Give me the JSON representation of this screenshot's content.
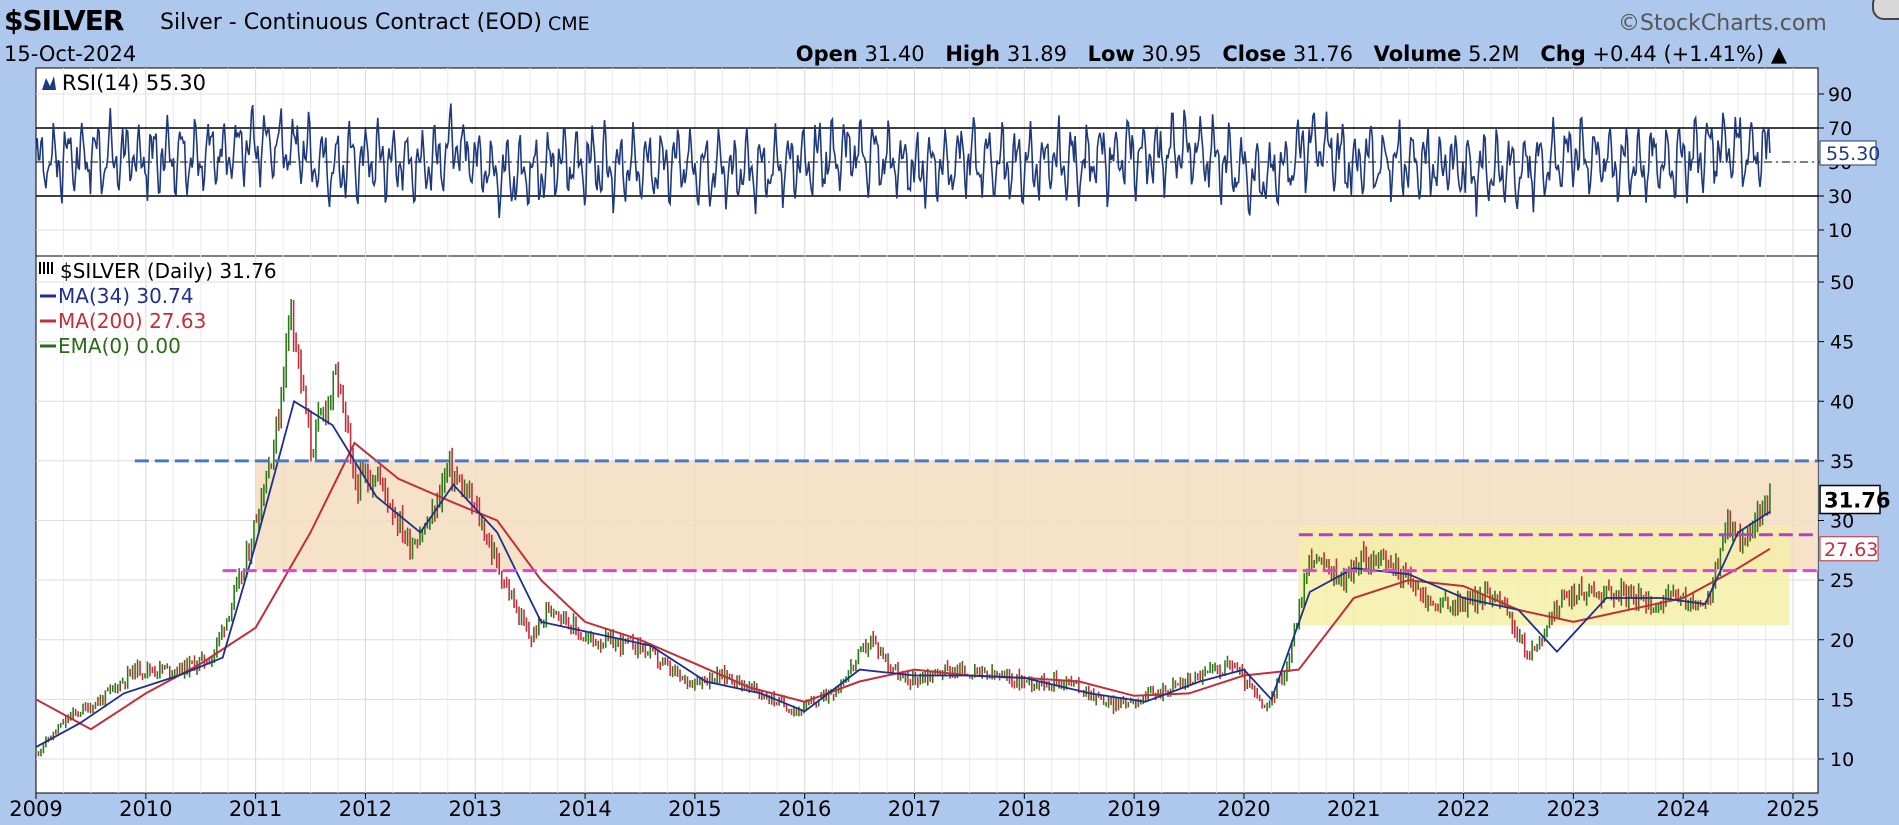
{
  "header": {
    "symbol": "$SILVER",
    "description": "Silver - Continuous Contract (EOD)",
    "exchange": "CME",
    "date": "15-Oct-2024",
    "brand": "©StockCharts.com",
    "open_label": "Open",
    "open": "31.40",
    "high_label": "High",
    "high": "31.89",
    "low_label": "Low",
    "low": "30.95",
    "close_label": "Close",
    "close": "31.76",
    "volume_label": "Volume",
    "volume": "5.2M",
    "chg_label": "Chg",
    "chg": "+0.44 (+1.41%)",
    "chg_arrow": "▲"
  },
  "rsi_panel": {
    "legend": "RSI(14) 55.30",
    "last_value_tag": "55.30",
    "ticks": [
      90,
      70,
      50,
      30,
      10
    ],
    "tick_labels": [
      "90",
      "70",
      "50",
      "30",
      "10"
    ]
  },
  "price_panel": {
    "legend": [
      {
        "text": "$SILVER (Daily) 31.76",
        "color": "#000000"
      },
      {
        "text": "MA(34) 30.74",
        "color": "#1f2f8a"
      },
      {
        "text": "MA(200) 27.63",
        "color": "#c0303a"
      },
      {
        "text": "EMA(0) 0.00",
        "color": "#2a6a1a"
      }
    ],
    "close_tag": "31.76",
    "ma200_tag": "27.63",
    "x_labels": [
      "2009",
      "2010",
      "2011",
      "2012",
      "2013",
      "2014",
      "2015",
      "2016",
      "2017",
      "2018",
      "2019",
      "2020",
      "2021",
      "2022",
      "2023",
      "2024",
      "2025"
    ],
    "y_labels": [
      "50",
      "45",
      "40",
      "35",
      "30",
      "25",
      "20",
      "15",
      "10"
    ]
  },
  "chart_data": [
    {
      "type": "line",
      "title": "RSI(14)",
      "ylim": [
        0,
        100
      ],
      "reference_lines": [
        70,
        50,
        30
      ],
      "last_value": 55.3,
      "series": [
        {
          "name": "RSI(14)",
          "color": "#1f3a7a",
          "x": [
            2009.0,
            2009.5,
            2010.0,
            2010.5,
            2011.0,
            2011.3,
            2011.7,
            2012.0,
            2012.5,
            2012.8,
            2013.3,
            2013.7,
            2014.0,
            2014.5,
            2015.0,
            2015.5,
            2016.0,
            2016.5,
            2017.0,
            2017.5,
            2018.0,
            2018.5,
            2019.0,
            2019.5,
            2020.0,
            2020.2,
            2020.6,
            2021.0,
            2021.5,
            2022.0,
            2022.5,
            2023.0,
            2023.5,
            2024.0,
            2024.4,
            2024.79
          ],
          "values": [
            50,
            62,
            55,
            65,
            72,
            80,
            42,
            55,
            45,
            78,
            25,
            45,
            50,
            40,
            48,
            30,
            55,
            65,
            40,
            55,
            45,
            50,
            60,
            70,
            40,
            15,
            82,
            45,
            55,
            40,
            35,
            65,
            45,
            55,
            80,
            55.3
          ]
        }
      ]
    },
    {
      "type": "line",
      "title": "$SILVER (Daily) 31.76",
      "ylim": [
        8,
        51
      ],
      "x_range": [
        2009.0,
        2025.0
      ],
      "series": [
        {
          "name": "$SILVER (Daily)",
          "color": "#2a6a1a",
          "x": [
            2009.0,
            2009.3,
            2009.6,
            2009.9,
            2010.3,
            2010.6,
            2010.9,
            2011.0,
            2011.2,
            2011.32,
            2011.5,
            2011.65,
            2011.75,
            2011.9,
            2012.1,
            2012.4,
            2012.6,
            2012.75,
            2013.0,
            2013.3,
            2013.5,
            2013.7,
            2014.0,
            2014.5,
            2014.9,
            2015.3,
            2015.7,
            2015.95,
            2016.3,
            2016.6,
            2016.9,
            2017.3,
            2017.7,
            2018.0,
            2018.4,
            2018.8,
            2019.2,
            2019.6,
            2019.9,
            2020.2,
            2020.4,
            2020.6,
            2020.9,
            2021.1,
            2021.4,
            2021.7,
            2022.0,
            2022.3,
            2022.6,
            2022.9,
            2023.1,
            2023.4,
            2023.7,
            2023.95,
            2024.2,
            2024.4,
            2024.55,
            2024.7,
            2024.79
          ],
          "values": [
            10.5,
            13.5,
            15.0,
            17.5,
            17.5,
            18.5,
            26.0,
            30.0,
            38.0,
            48.5,
            36.0,
            40.0,
            42.0,
            33.0,
            34.0,
            28.0,
            30.0,
            34.5,
            31.0,
            24.0,
            20.0,
            23.0,
            20.0,
            19.5,
            16.5,
            17.0,
            15.0,
            14.0,
            16.0,
            20.0,
            16.5,
            17.5,
            17.0,
            16.5,
            16.5,
            14.5,
            15.5,
            17.0,
            18.0,
            14.0,
            18.0,
            27.0,
            25.0,
            27.0,
            26.0,
            23.0,
            23.0,
            24.0,
            18.5,
            23.5,
            24.0,
            24.0,
            23.0,
            23.5,
            22.5,
            29.5,
            28.5,
            30.5,
            31.76
          ]
        },
        {
          "name": "MA(34)",
          "color": "#1f2f8a",
          "x": [
            2009.0,
            2009.4,
            2009.8,
            2010.3,
            2010.7,
            2011.0,
            2011.35,
            2011.7,
            2012.1,
            2012.5,
            2012.8,
            2013.2,
            2013.6,
            2014.1,
            2014.6,
            2015.1,
            2015.6,
            2016.0,
            2016.5,
            2017.0,
            2017.5,
            2018.0,
            2018.6,
            2019.1,
            2019.6,
            2020.0,
            2020.25,
            2020.6,
            2021.0,
            2021.5,
            2022.0,
            2022.5,
            2022.85,
            2023.3,
            2023.8,
            2024.2,
            2024.5,
            2024.79
          ],
          "values": [
            11.0,
            13.0,
            15.5,
            17.0,
            18.5,
            28.0,
            40.0,
            38.0,
            32.0,
            29.0,
            33.0,
            29.0,
            21.5,
            20.5,
            19.5,
            16.5,
            15.5,
            14.0,
            17.5,
            17.0,
            17.0,
            16.8,
            15.5,
            14.8,
            16.5,
            17.5,
            15.0,
            24.0,
            26.0,
            25.5,
            23.5,
            22.5,
            19.0,
            23.5,
            23.5,
            23.0,
            29.0,
            30.74
          ]
        },
        {
          "name": "MA(200)",
          "color": "#c0303a",
          "x": [
            2009.0,
            2009.5,
            2010.0,
            2010.5,
            2011.0,
            2011.5,
            2011.9,
            2012.3,
            2012.8,
            2013.2,
            2013.6,
            2014.0,
            2014.5,
            2015.0,
            2015.5,
            2016.0,
            2016.5,
            2017.0,
            2017.5,
            2018.0,
            2018.5,
            2019.0,
            2019.5,
            2020.0,
            2020.5,
            2021.0,
            2021.5,
            2022.0,
            2022.5,
            2023.0,
            2023.5,
            2024.0,
            2024.5,
            2024.79
          ],
          "values": [
            15.0,
            12.5,
            15.5,
            18.0,
            21.0,
            29.0,
            36.5,
            33.5,
            31.5,
            30.0,
            25.0,
            21.5,
            20.0,
            18.0,
            16.0,
            14.8,
            16.5,
            17.5,
            17.0,
            16.8,
            16.5,
            15.3,
            15.5,
            17.0,
            17.5,
            23.5,
            25.0,
            24.5,
            22.5,
            21.5,
            22.5,
            23.5,
            26.0,
            27.63
          ]
        }
      ],
      "annotations": [
        {
          "type": "hline",
          "value": 35.0,
          "color": "#4a78c8",
          "style": "dashed",
          "x_from": 2009.9
        },
        {
          "type": "hline",
          "value": 25.8,
          "color": "#e040e0",
          "style": "dashed",
          "x_from": 2010.7
        },
        {
          "type": "hline",
          "value": 28.8,
          "color": "#b040d0",
          "style": "dashed",
          "x_from": 2020.5
        },
        {
          "type": "zone",
          "y_from": 25.8,
          "y_to": 35.0,
          "x_from": 2011.0,
          "color": "#f5ddc0"
        },
        {
          "type": "zone",
          "y_from": 21.2,
          "y_to": 29.5,
          "x_from": 2020.5,
          "x_to": 2024.97,
          "color": "#f5efa8"
        }
      ]
    }
  ]
}
